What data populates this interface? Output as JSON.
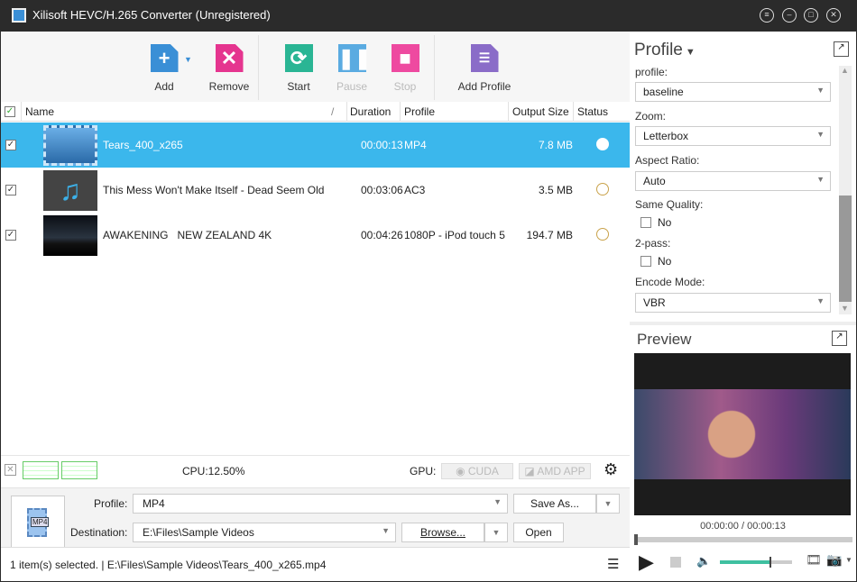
{
  "window": {
    "title": "Xilisoft HEVC/H.265 Converter (Unregistered)"
  },
  "toolbar": {
    "add": "Add",
    "remove": "Remove",
    "start": "Start",
    "pause": "Pause",
    "stop": "Stop",
    "add_profile": "Add Profile"
  },
  "columns": {
    "name": "Name",
    "duration": "Duration",
    "profile": "Profile",
    "output_size": "Output Size",
    "status": "Status"
  },
  "files": [
    {
      "name": "Tears_400_x265",
      "duration": "00:00:13",
      "profile": "MP4",
      "size": "7.8 MB",
      "checked": true,
      "selected": true
    },
    {
      "name": "This Mess Won't Make Itself - Dead Seem Old",
      "duration": "00:03:06",
      "profile": "AC3",
      "size": "3.5 MB",
      "checked": true
    },
    {
      "name": "AWAKENING   NEW ZEALAND 4K",
      "duration": "00:04:26",
      "profile": "1080P - iPod touch 5",
      "size": "194.7 MB",
      "checked": true
    }
  ],
  "cpu": {
    "label": "CPU:12.50%",
    "gpu_label": "GPU:",
    "cuda": "CUDA",
    "amd": "AMD APP"
  },
  "output": {
    "profile_label": "Profile:",
    "profile_value": "MP4",
    "save_as": "Save As...",
    "destination_label": "Destination:",
    "destination_value": "E:\\Files\\Sample Videos",
    "browse": "Browse...",
    "open": "Open",
    "format_badge": "MP4"
  },
  "status": {
    "text": "1 item(s) selected. | E:\\Files\\Sample Videos\\Tears_400_x265.mp4"
  },
  "profile_panel": {
    "title": "Profile",
    "profile_label": "profile:",
    "profile_value": "baseline",
    "zoom_label": "Zoom:",
    "zoom_value": "Letterbox",
    "aspect_label": "Aspect Ratio:",
    "aspect_value": "Auto",
    "same_quality_label": "Same Quality:",
    "same_quality_value": "No",
    "twopass_label": "2-pass:",
    "twopass_value": "No",
    "encode_label": "Encode Mode:",
    "encode_value": "VBR"
  },
  "preview": {
    "title": "Preview",
    "time": "00:00:00 / 00:00:13",
    "progress": 0,
    "volume": 0.7
  },
  "colors": {
    "accent": "#3bb7ec",
    "add": "#3a8fd6",
    "remove": "#e5358f",
    "start": "#2ab594",
    "pause": "#4aa3df",
    "stop": "#ee4aa0",
    "add_profile": "#8a6cc8",
    "volume": "#3fc0a0"
  }
}
